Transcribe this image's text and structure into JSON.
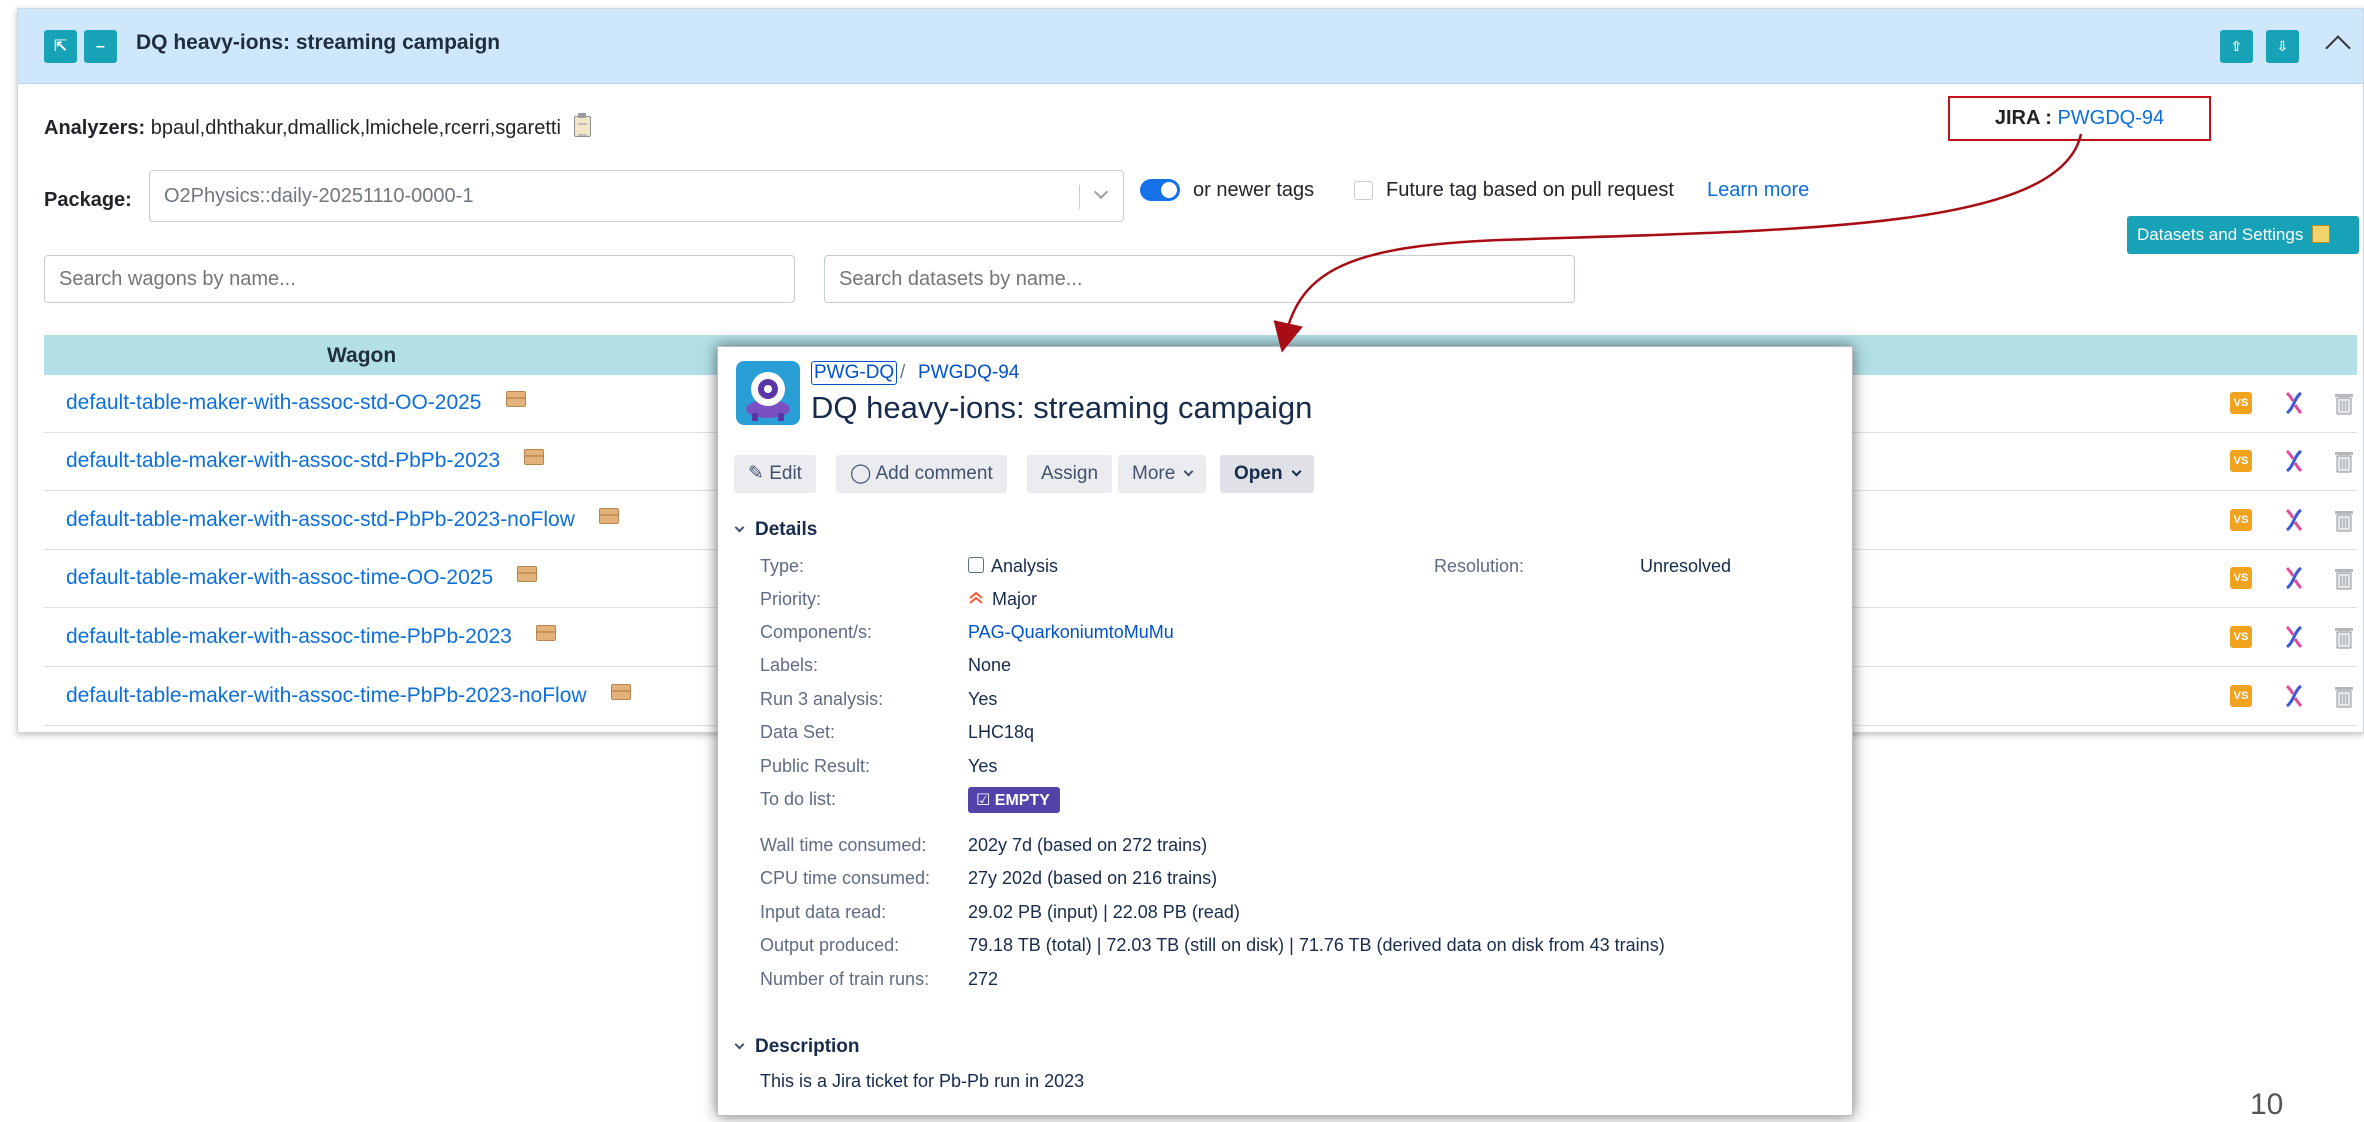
{
  "panel": {
    "title": "DQ heavy-ions: streaming campaign",
    "analyzers_label": "Analyzers:",
    "analyzers_value": "bpaul,dhthakur,dmallick,lmichele,rcerri,sgaretti",
    "jira_label": "JIRA :",
    "jira_key": "PWGDQ-94",
    "package_label": "Package:",
    "package_value": "O2Physics::daily-20251110-0000-1",
    "newer_tags_label": "or newer tags",
    "future_tag_label": "Future tag based on pull request",
    "learn_more": "Learn more",
    "datasets_button": "Datasets and Settings",
    "search_wagons_placeholder": "Search wagons by name...",
    "search_datasets_placeholder": "Search datasets by name...",
    "table_header_wagon": "Wagon",
    "wagons": [
      "default-table-maker-with-assoc-std-OO-2025",
      "default-table-maker-with-assoc-std-PbPb-2023",
      "default-table-maker-with-assoc-std-PbPb-2023-noFlow",
      "default-table-maker-with-assoc-time-OO-2025",
      "default-table-maker-with-assoc-time-PbPb-2023",
      "default-table-maker-with-assoc-time-PbPb-2023-noFlow"
    ],
    "vs_label": "VS",
    "colors": {
      "accent": "#17a2b8",
      "header_bg": "#cfe7fb",
      "link": "#0d6fdc",
      "jira_box": "#c0121b"
    }
  },
  "card": {
    "project": "PWG-DQ",
    "separator": "/",
    "issue_key": "PWGDQ-94",
    "title": "DQ heavy-ions: streaming campaign",
    "buttons": {
      "edit": "Edit",
      "comment": "Add comment",
      "assign": "Assign",
      "more": "More",
      "open": "Open"
    },
    "details_heading": "Details",
    "fields": {
      "type_label": "Type:",
      "type_value": "Analysis",
      "resolution_label": "Resolution:",
      "resolution_value": "Unresolved",
      "priority_label": "Priority:",
      "priority_value": "Major",
      "component_label": "Component/s:",
      "component_value": "PAG-QuarkoniumtoMuMu",
      "labels_label": "Labels:",
      "labels_value": "None",
      "run3_label": "Run 3 analysis:",
      "run3_value": "Yes",
      "dataset_label": "Data Set:",
      "dataset_value": "LHC18q",
      "public_label": "Public Result:",
      "public_value": "Yes",
      "todo_label": "To do list:",
      "todo_value": "EMPTY",
      "wall_label": "Wall time consumed:",
      "wall_value": "202y 7d (based on 272 trains)",
      "cpu_label": "CPU time consumed:",
      "cpu_value": "27y 202d (based on 216 trains)",
      "input_label": "Input data read:",
      "input_value": "29.02 PB (input) | 22.08 PB (read)",
      "output_label": "Output produced:",
      "output_value": "79.18 TB (total) | 72.03 TB (still on disk) | 71.76 TB (derived data on disk from 43 trains)",
      "runs_label": "Number of train runs:",
      "runs_value": "272"
    },
    "description_heading": "Description",
    "description_text": "This is a Jira ticket for Pb-Pb run in 2023"
  },
  "page_number": "10"
}
